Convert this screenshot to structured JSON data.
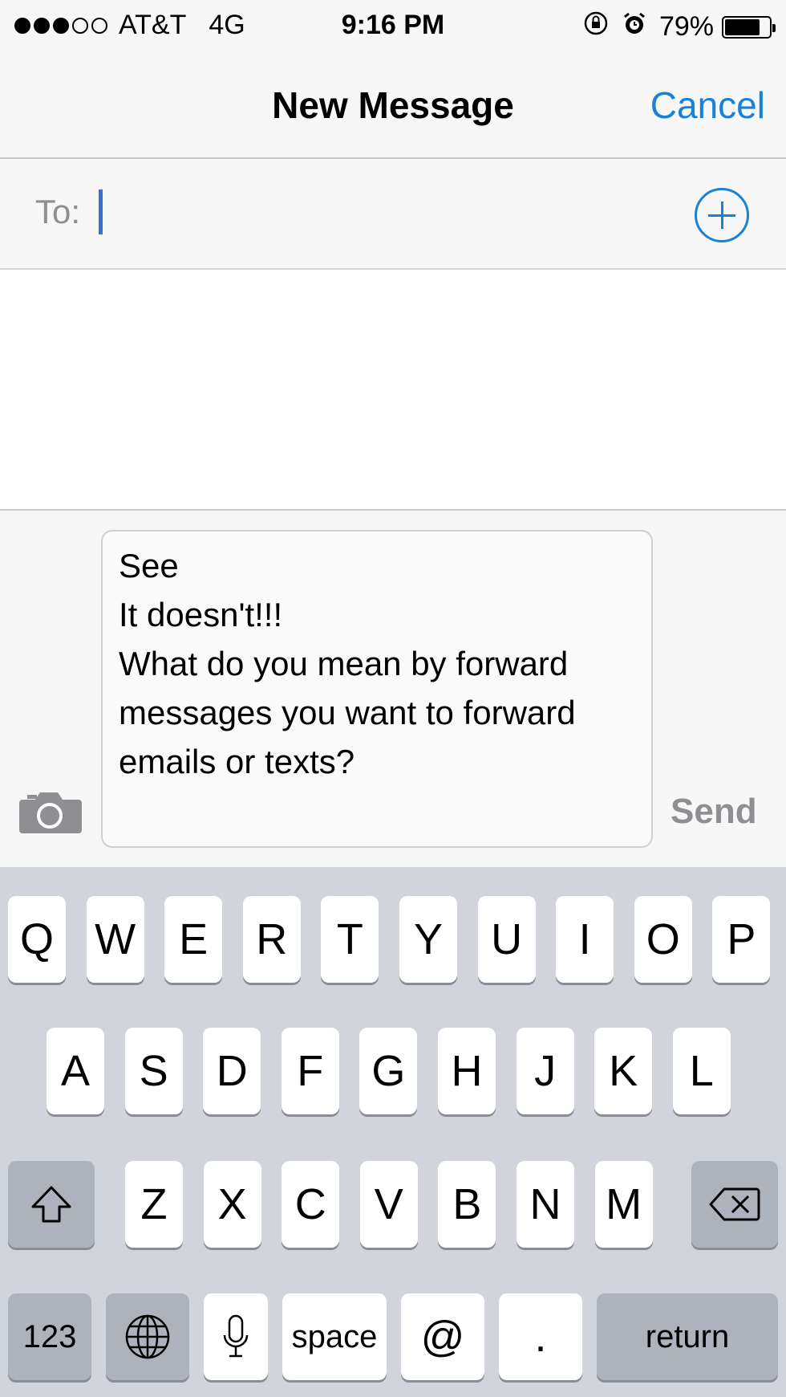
{
  "status_bar": {
    "signal_filled": 3,
    "signal_total": 5,
    "carrier": "AT&T",
    "network": "4G",
    "time": "9:16 PM",
    "battery_percent": "79%",
    "battery_level": 0.79,
    "icons": [
      "rotation-lock-icon",
      "alarm-icon"
    ]
  },
  "nav": {
    "title": "New Message",
    "cancel_label": "Cancel"
  },
  "to_field": {
    "label": "To:",
    "value": "",
    "add_icon": "plus-circle-icon"
  },
  "compose": {
    "message_text": "See\nIt doesn't!!!\nWhat do you mean by forward messages you want to forward emails or texts?",
    "send_label": "Send",
    "camera_icon": "camera-icon"
  },
  "keyboard": {
    "row1": [
      "Q",
      "W",
      "E",
      "R",
      "T",
      "Y",
      "U",
      "I",
      "O",
      "P"
    ],
    "row2": [
      "A",
      "S",
      "D",
      "F",
      "G",
      "H",
      "J",
      "K",
      "L"
    ],
    "row3": [
      "Z",
      "X",
      "C",
      "V",
      "B",
      "N",
      "M"
    ],
    "shift_icon": "shift-icon",
    "delete_icon": "delete-icon",
    "numbers_label": "123",
    "globe_icon": "globe-icon",
    "mic_icon": "microphone-icon",
    "space_label": "space",
    "at_label": "@",
    "period_label": ".",
    "return_label": "return"
  },
  "colors": {
    "accent": "#1a82d6",
    "cursor": "#3a6fd8",
    "muted": "#8e8e93",
    "keyboard_bg": "#d1d5db"
  }
}
